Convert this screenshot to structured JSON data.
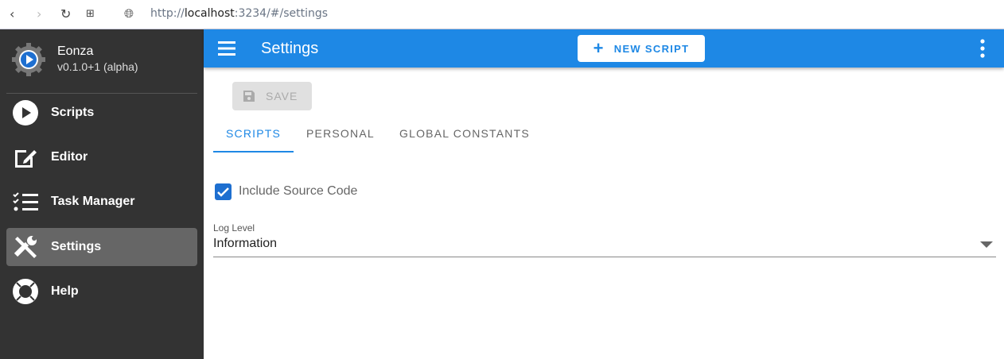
{
  "browser": {
    "url_prefix": "http://",
    "url_host": "localhost",
    "url_rest": ":3234/#/settings"
  },
  "app": {
    "name": "Eonza",
    "version": "v0.1.0+1 (alpha)"
  },
  "nav": [
    {
      "label": "Scripts"
    },
    {
      "label": "Editor"
    },
    {
      "label": "Task Manager"
    },
    {
      "label": "Settings"
    },
    {
      "label": "Help"
    }
  ],
  "header": {
    "title": "Settings",
    "new_script": "NEW SCRIPT"
  },
  "toolbar": {
    "save": "SAVE"
  },
  "tabs": [
    {
      "label": "SCRIPTS"
    },
    {
      "label": "PERSONAL"
    },
    {
      "label": "GLOBAL CONSTANTS"
    }
  ],
  "form": {
    "include_source": "Include Source Code",
    "log_level_label": "Log Level",
    "log_level_value": "Information"
  },
  "colors": {
    "primary": "#1e88e5",
    "sidebar": "#333333"
  }
}
